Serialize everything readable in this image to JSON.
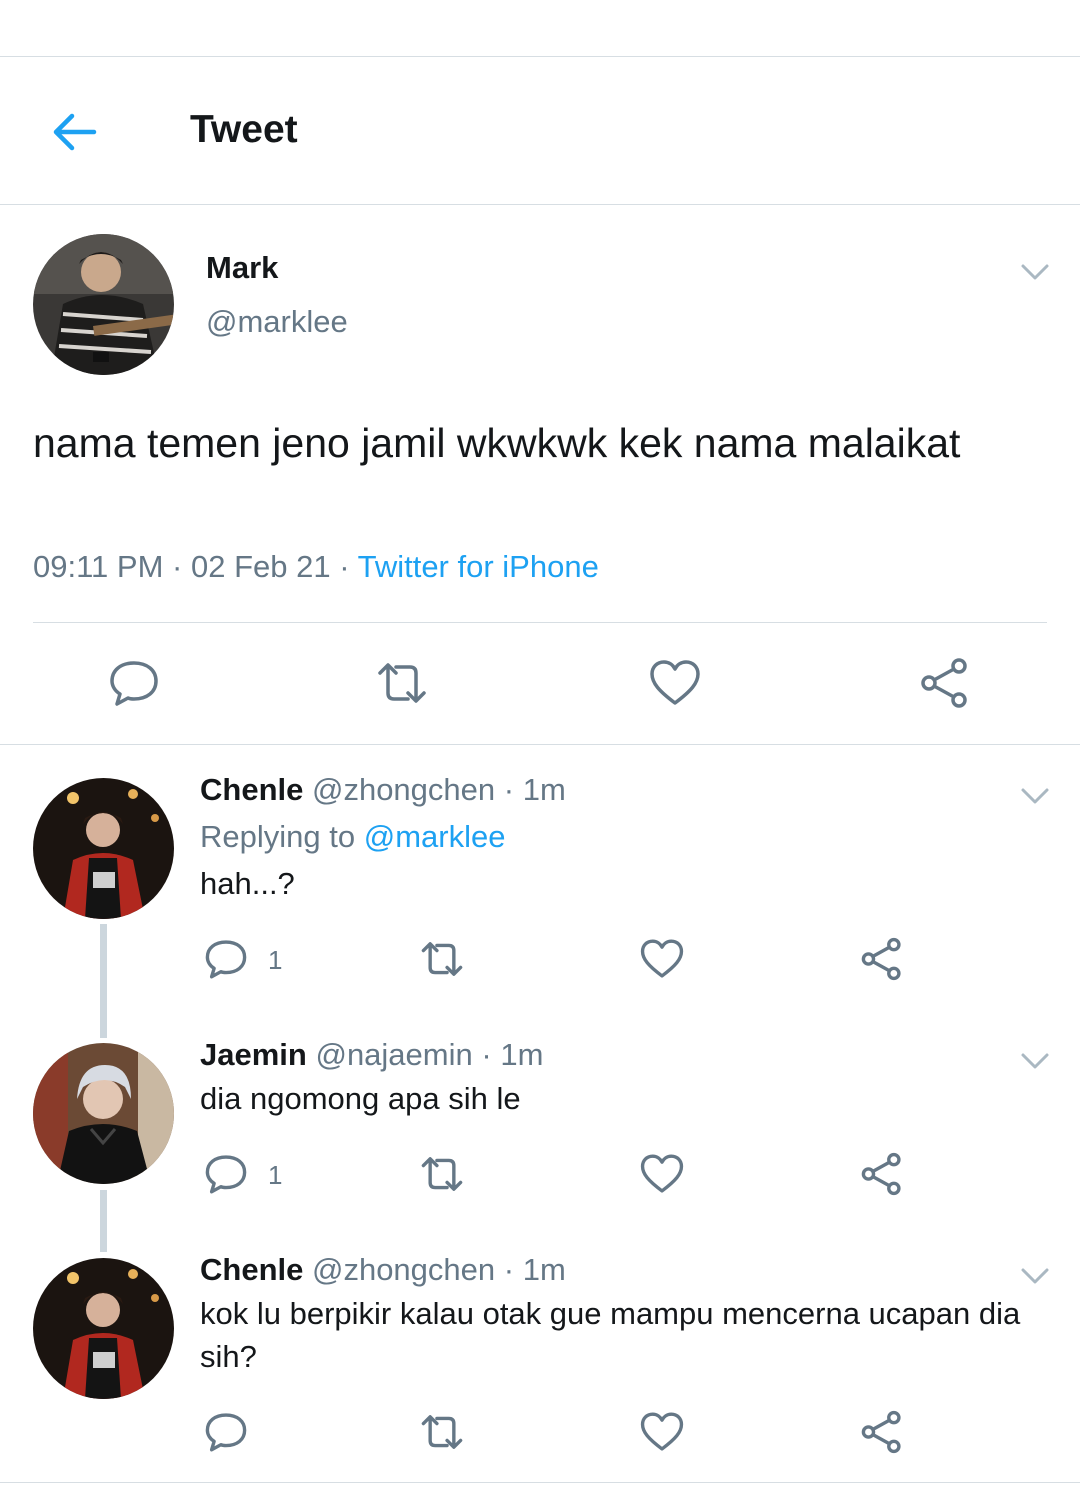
{
  "header": {
    "title": "Tweet",
    "back_icon": "arrow-left-icon",
    "accent": "#1da1f2"
  },
  "main_tweet": {
    "name": "Mark",
    "handle": "@marklee",
    "text": "nama temen jeno jamil wkwkwk kek nama malaikat",
    "time": "09:11 PM",
    "date": "02 Feb 21",
    "source": "Twitter for iPhone",
    "actions": [
      "reply-icon",
      "retweet-icon",
      "like-icon",
      "share-icon"
    ]
  },
  "replies": [
    {
      "name": "Chenle",
      "handle": "@zhongchen",
      "age": "1m",
      "replying_prefix": "Replying to",
      "replying_to": "@marklee",
      "text": "hah...?",
      "reply_count": "1"
    },
    {
      "name": "Jaemin",
      "handle": "@najaemin",
      "age": "1m",
      "text": "dia ngomong apa sih le",
      "reply_count": "1"
    },
    {
      "name": "Chenle",
      "handle": "@zhongchen",
      "age": "1m",
      "text": "kok lu berpikir kalau otak gue mampu mencerna ucapan dia sih?",
      "reply_count": ""
    }
  ],
  "separator": "·"
}
